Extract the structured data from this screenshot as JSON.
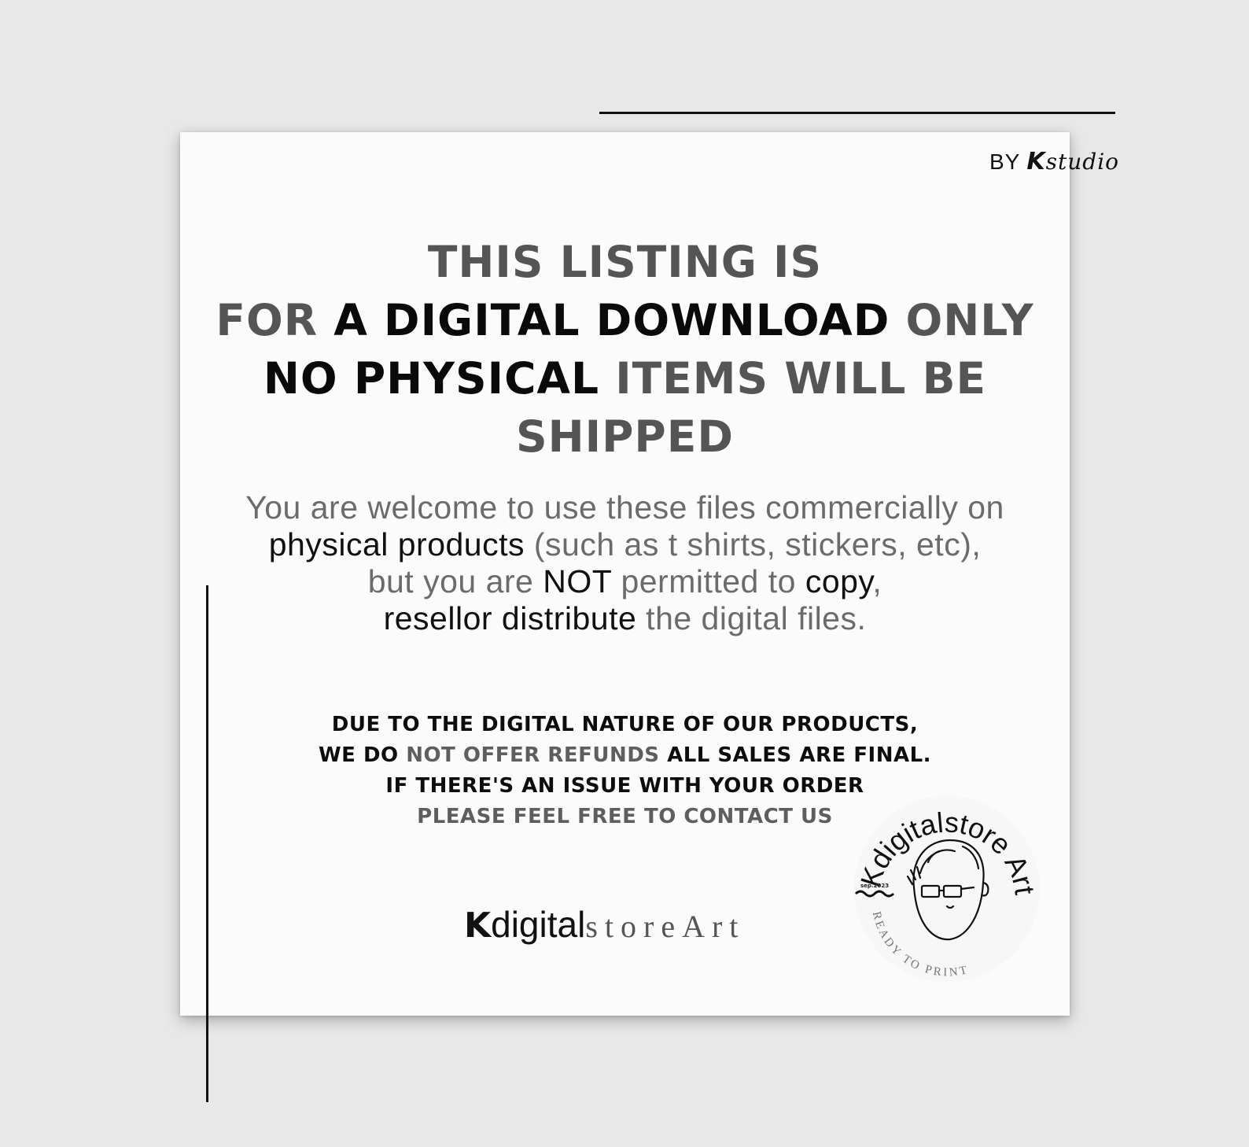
{
  "byline": {
    "by": "BY",
    "brand_k": "K",
    "brand_studio": "studio"
  },
  "headline": {
    "line1": "THIS LISTING IS",
    "line2_a": "FOR ",
    "line2_b": "A DIGITAL DOWNLOAD",
    "line2_c": " ONLY",
    "line3_a": "NO PHYSICAL",
    "line3_b": " ITEMS WILL BE",
    "line4": "SHIPPED"
  },
  "body": {
    "line1": "You are welcome to use these files commercially on",
    "line2_a": "physical products",
    "line2_b": " (such as t shirts, stickers, etc),",
    "line3_a": "but you are ",
    "line3_b": "NOT",
    "line3_c": " permitted to ",
    "line3_d": "copy",
    "line3_e": ",",
    "line4_a": "resellor distribute",
    "line4_b": " the digital files."
  },
  "notice": {
    "line1": "DUE TO THE DIGITAL NATURE OF OUR PRODUCTS,",
    "line2_a": "WE DO ",
    "line2_b": "NOT OFFER REFUNDS",
    "line2_c": " ALL SALES ARE FINAL.",
    "line3": "IF THERE'S AN ISSUE WITH YOUR ORDER",
    "line4": "PLEASE FEEL FREE TO CONTACT US"
  },
  "wordmark": {
    "k": "K",
    "digital": "digital",
    "store": "storeArt"
  },
  "seal": {
    "text_top": "Kdigitalstore Art",
    "text_bottom": "READY TO PRINT",
    "date": "sep.2023"
  }
}
